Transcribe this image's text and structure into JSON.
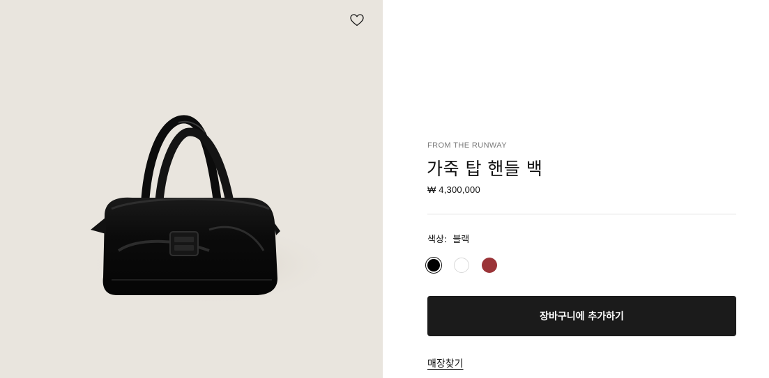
{
  "product": {
    "eyebrow": "FROM THE RUNWAY",
    "name": "가죽 탑 핸들 백",
    "price": "₩ 4,300,000"
  },
  "color": {
    "label": "색상:",
    "selected_value": "블랙",
    "swatches": [
      {
        "name": "black",
        "hex": "#000000",
        "selected": true
      },
      {
        "name": "white",
        "hex": "#ffffff",
        "selected": false
      },
      {
        "name": "red",
        "hex": "#9b3438",
        "selected": false
      }
    ]
  },
  "actions": {
    "add_to_cart": "장바구니에 추가하기",
    "find_store": "매장찾기"
  },
  "icons": {
    "wishlist": "heart-icon"
  },
  "colors": {
    "image_background": "#e9e5de",
    "button_background": "#1b1b1b"
  }
}
